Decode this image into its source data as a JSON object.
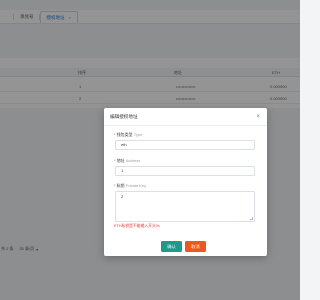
{
  "tabs": [
    {
      "label": ""
    },
    {
      "label": "承兑号"
    },
    {
      "label": "授权地址",
      "close": "×"
    }
  ],
  "table": {
    "headers": [
      "排序",
      "地址",
      "ETH"
    ],
    "rows": [
      {
        "index": "1",
        "address": "••••••••••••••",
        "eth": "0.000000"
      },
      {
        "index": "2",
        "address": "••••••••••••••",
        "eth": "0.000000"
      }
    ]
  },
  "pager": {
    "total": "共 2 条",
    "size": "20 条/页",
    "arrow": "▾"
  },
  "modal": {
    "title": "编辑授权地址",
    "close": "×",
    "type_label": "钱包类型",
    "type_hint": "Type",
    "type_value": "eth",
    "address_label": "地址",
    "address_hint": "Address",
    "address_value": "1",
    "key_label": "私钥",
    "key_hint": "Private Key",
    "key_value": "2",
    "error": "ETH私钥是不能输入开头0x",
    "ok": "确认",
    "cancel": "取消"
  }
}
